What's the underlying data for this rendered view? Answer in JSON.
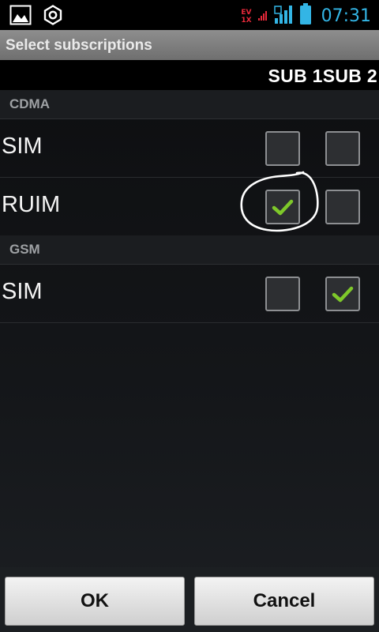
{
  "status_bar": {
    "left_icons": [
      "image-icon",
      "hexagon-settings-icon"
    ],
    "net_labels": [
      "EV",
      "1X"
    ],
    "clock": "07:31",
    "colors": {
      "clock": "#33b5e5",
      "net": "#e8293a"
    }
  },
  "dialog": {
    "title": "Select subscriptions",
    "column_header": "SUB 1SUB 2",
    "sections": [
      {
        "label": "CDMA",
        "rows": [
          {
            "label": "SIM",
            "sub1_checked": false,
            "sub2_checked": false
          },
          {
            "label": "RUIM",
            "sub1_checked": true,
            "sub2_checked": false
          }
        ]
      },
      {
        "label": "GSM",
        "rows": [
          {
            "label": "SIM",
            "sub1_checked": false,
            "sub2_checked": true
          }
        ]
      }
    ],
    "buttons": {
      "ok": "OK",
      "cancel": "Cancel"
    },
    "check_color": "#7ec82a"
  }
}
